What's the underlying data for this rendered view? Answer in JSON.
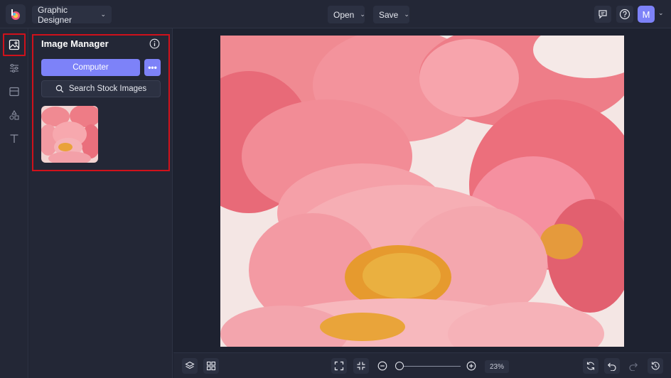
{
  "header": {
    "app_mode": "Graphic Designer",
    "open_label": "Open",
    "save_label": "Save",
    "avatar_initial": "M"
  },
  "panel": {
    "title": "Image Manager",
    "computer_label": "Computer",
    "more_label": "•••",
    "stock_label": "Search Stock Images"
  },
  "zoom": {
    "percent": "23%",
    "level": 0.0
  },
  "colors": {
    "accent": "#7d82f8",
    "highlight": "#d0111b",
    "background": "#1e2230"
  },
  "icons": {
    "leftbar": [
      "image-icon",
      "sliders-icon",
      "layout-icon",
      "shapes-icon",
      "text-icon"
    ]
  }
}
